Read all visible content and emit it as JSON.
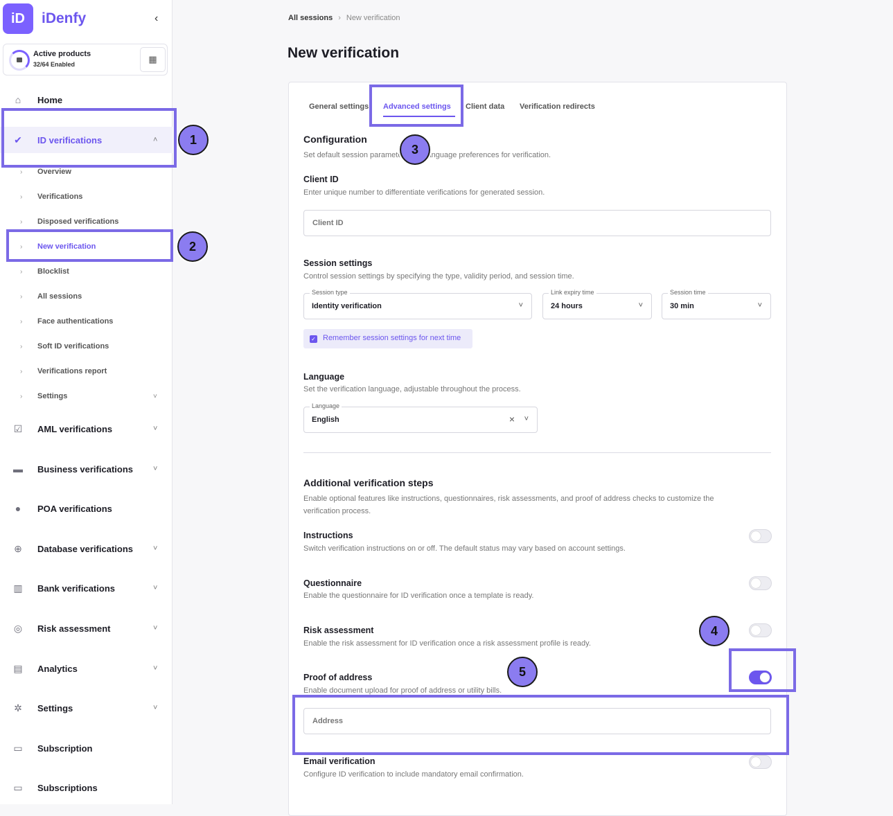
{
  "app": {
    "logo_badge": "iD",
    "name": "iDenfy"
  },
  "products": {
    "title": "Active products",
    "subtitle": "32/64 Enabled"
  },
  "sidebar": {
    "items": [
      {
        "label": "Home",
        "icon": "home-icon"
      },
      {
        "label": "ID verifications",
        "icon": "user-check-icon"
      },
      {
        "label": "AML verifications",
        "icon": "clipboard-check-icon"
      },
      {
        "label": "Business verifications",
        "icon": "briefcase-icon"
      },
      {
        "label": "POA verifications",
        "icon": "location-pin-icon"
      },
      {
        "label": "Database verifications",
        "icon": "globe-icon"
      },
      {
        "label": "Bank verifications",
        "icon": "bank-icon"
      },
      {
        "label": "Risk assessment",
        "icon": "target-icon"
      },
      {
        "label": "Analytics",
        "icon": "bar-chart-icon"
      },
      {
        "label": "Settings",
        "icon": "gear-icon"
      },
      {
        "label": "Subscription",
        "icon": "monitor-icon"
      },
      {
        "label": "Subscriptions",
        "icon": "monitor-icon"
      }
    ],
    "sub_items": [
      "Overview",
      "Verifications",
      "Disposed verifications",
      "New verification",
      "Blocklist",
      "All sessions",
      "Face authentications",
      "Soft ID verifications",
      "Verifications report",
      "Settings"
    ]
  },
  "steps": [
    "1",
    "2",
    "3",
    "4",
    "5"
  ],
  "breadcrumb": {
    "parent": "All sessions",
    "separator": "›",
    "current": "New verification"
  },
  "page_title": "New verification",
  "tabs": [
    "General settings",
    "Advanced settings",
    "Client data",
    "Verification redirects"
  ],
  "configuration": {
    "title": "Configuration",
    "subtitle": "Set default session parameters and language preferences for verification."
  },
  "client_id": {
    "title": "Client ID",
    "subtitle": "Enter unique number to differentiate verifications for generated session.",
    "placeholder": "Client ID"
  },
  "session_settings": {
    "title": "Session settings",
    "subtitle": "Control session settings by specifying the type, validity period, and session time.",
    "session_type_label": "Session type",
    "session_type": "Identity verification",
    "link_expiry_label": "Link expiry time",
    "link_expiry": "24 hours",
    "session_time_label": "Session time",
    "session_time": "30 min",
    "remember": "Remember session settings for next time"
  },
  "language": {
    "title": "Language",
    "subtitle": "Set the verification language, adjustable throughout the process.",
    "field_label": "Language",
    "value": "English"
  },
  "additional": {
    "title": "Additional verification steps",
    "subtitle_1": "Enable optional features like instructions, questionnaires, risk assessments, and proof of address checks to customize the",
    "subtitle_2": "verification process.",
    "items": [
      {
        "title": "Instructions",
        "desc": "Switch verification instructions on or off. The default status may vary based on account settings.",
        "enabled": false
      },
      {
        "title": "Questionnaire",
        "desc": "Enable the questionnaire for ID verification once a template is ready.",
        "enabled": false
      },
      {
        "title": "Risk assessment",
        "desc": "Enable the risk assessment for ID verification once a risk assessment profile is ready.",
        "enabled": false
      },
      {
        "title": "Proof of address",
        "desc": "Enable document upload for proof of address or utility bills.",
        "enabled": true
      },
      {
        "title": "Email verification",
        "desc": "Configure ID verification to include mandatory email confirmation.",
        "enabled": false
      }
    ],
    "address_placeholder": "Address"
  },
  "colors": {
    "accent": "#6c56ee",
    "highlight": "#7b6ae6"
  }
}
